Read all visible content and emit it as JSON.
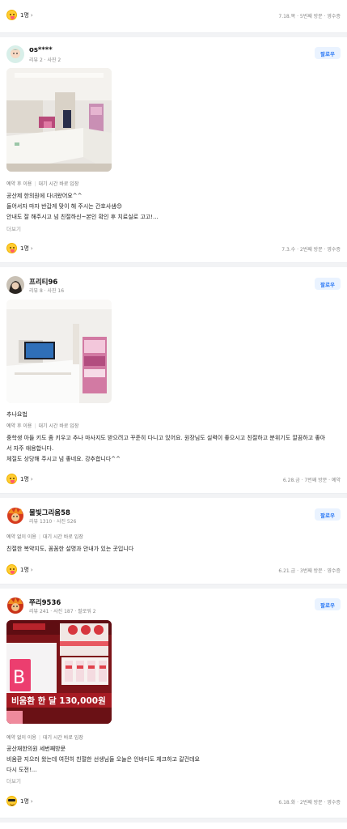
{
  "top_footer": {
    "count": "1명",
    "meta": "7.18.목 · 5번째 방문 · 영수증"
  },
  "follow_label": "팔로우",
  "more_label": "더보기",
  "reviews": [
    {
      "name": "os****",
      "stats": "리뷰 2 · 사진 2",
      "tags": [
        "예약 후 이용",
        "대기 시간 바로 입장"
      ],
      "lines": [
        "공산제 한의원에 다녀왔어요^^",
        "들어서자 마자 반갑게 맞이 해 주시는 간호사샘😊",
        "안내도 잘 해주시고 넘 친절하신~본인 확인 후 치료실로 고고!..."
      ],
      "count": "1명",
      "meta": "7.3.수 · 2번째 방문 · 영수증"
    },
    {
      "name": "프리티96",
      "stats": "리뷰 8 · 사진 16",
      "topic": "추나요법",
      "tags": [
        "예약 후 이용",
        "대기 시간 바로 입장"
      ],
      "lines": [
        "중학생 아들 키도 좀 키우고 추나 마사지도 받으려고 꾸준히 다니고 있어요. 원장님도 실력이 좋으시고 친절하고 분위기도 깔끔하고 좋아",
        "서 자주 애용합니다.",
        "체질도 상당해 주시고 넘 좋네요. 강추합니다^^"
      ],
      "count": "1명",
      "meta": "6.28.금 · 7번째 방문 · 예약"
    },
    {
      "name": "물빛그리움58",
      "stats": "리뷰 1310 · 사진 526",
      "tags": [
        "예약 없이 이용",
        "대기 시간 바로 입장"
      ],
      "lines": [
        "친절한 복약지도, 꼼꼼한 설명과 안내가 있는 곳입니다"
      ],
      "count": "1명",
      "meta": "6.21.금 · 3번째 방문 · 영수증"
    },
    {
      "name": "쭈리9536",
      "stats": "리뷰 241 · 사진 187 · 팔로워 2",
      "tags": [
        "예약 없이 이용",
        "대기 시간 바로 입장"
      ],
      "lines": [
        "공산재한의원 세번째방문",
        "비움환 지으러 왔는데 여전히 친절한 선생님들 오늘은 인바디도 체크하고 갈건데요",
        "다시 도전!..."
      ],
      "count": "1명",
      "meta": "6.18.화 · 2번째 방문 · 영수증",
      "photo_text": {
        "price": "비움환 한 달 130,000원",
        "brand": "B"
      }
    }
  ]
}
